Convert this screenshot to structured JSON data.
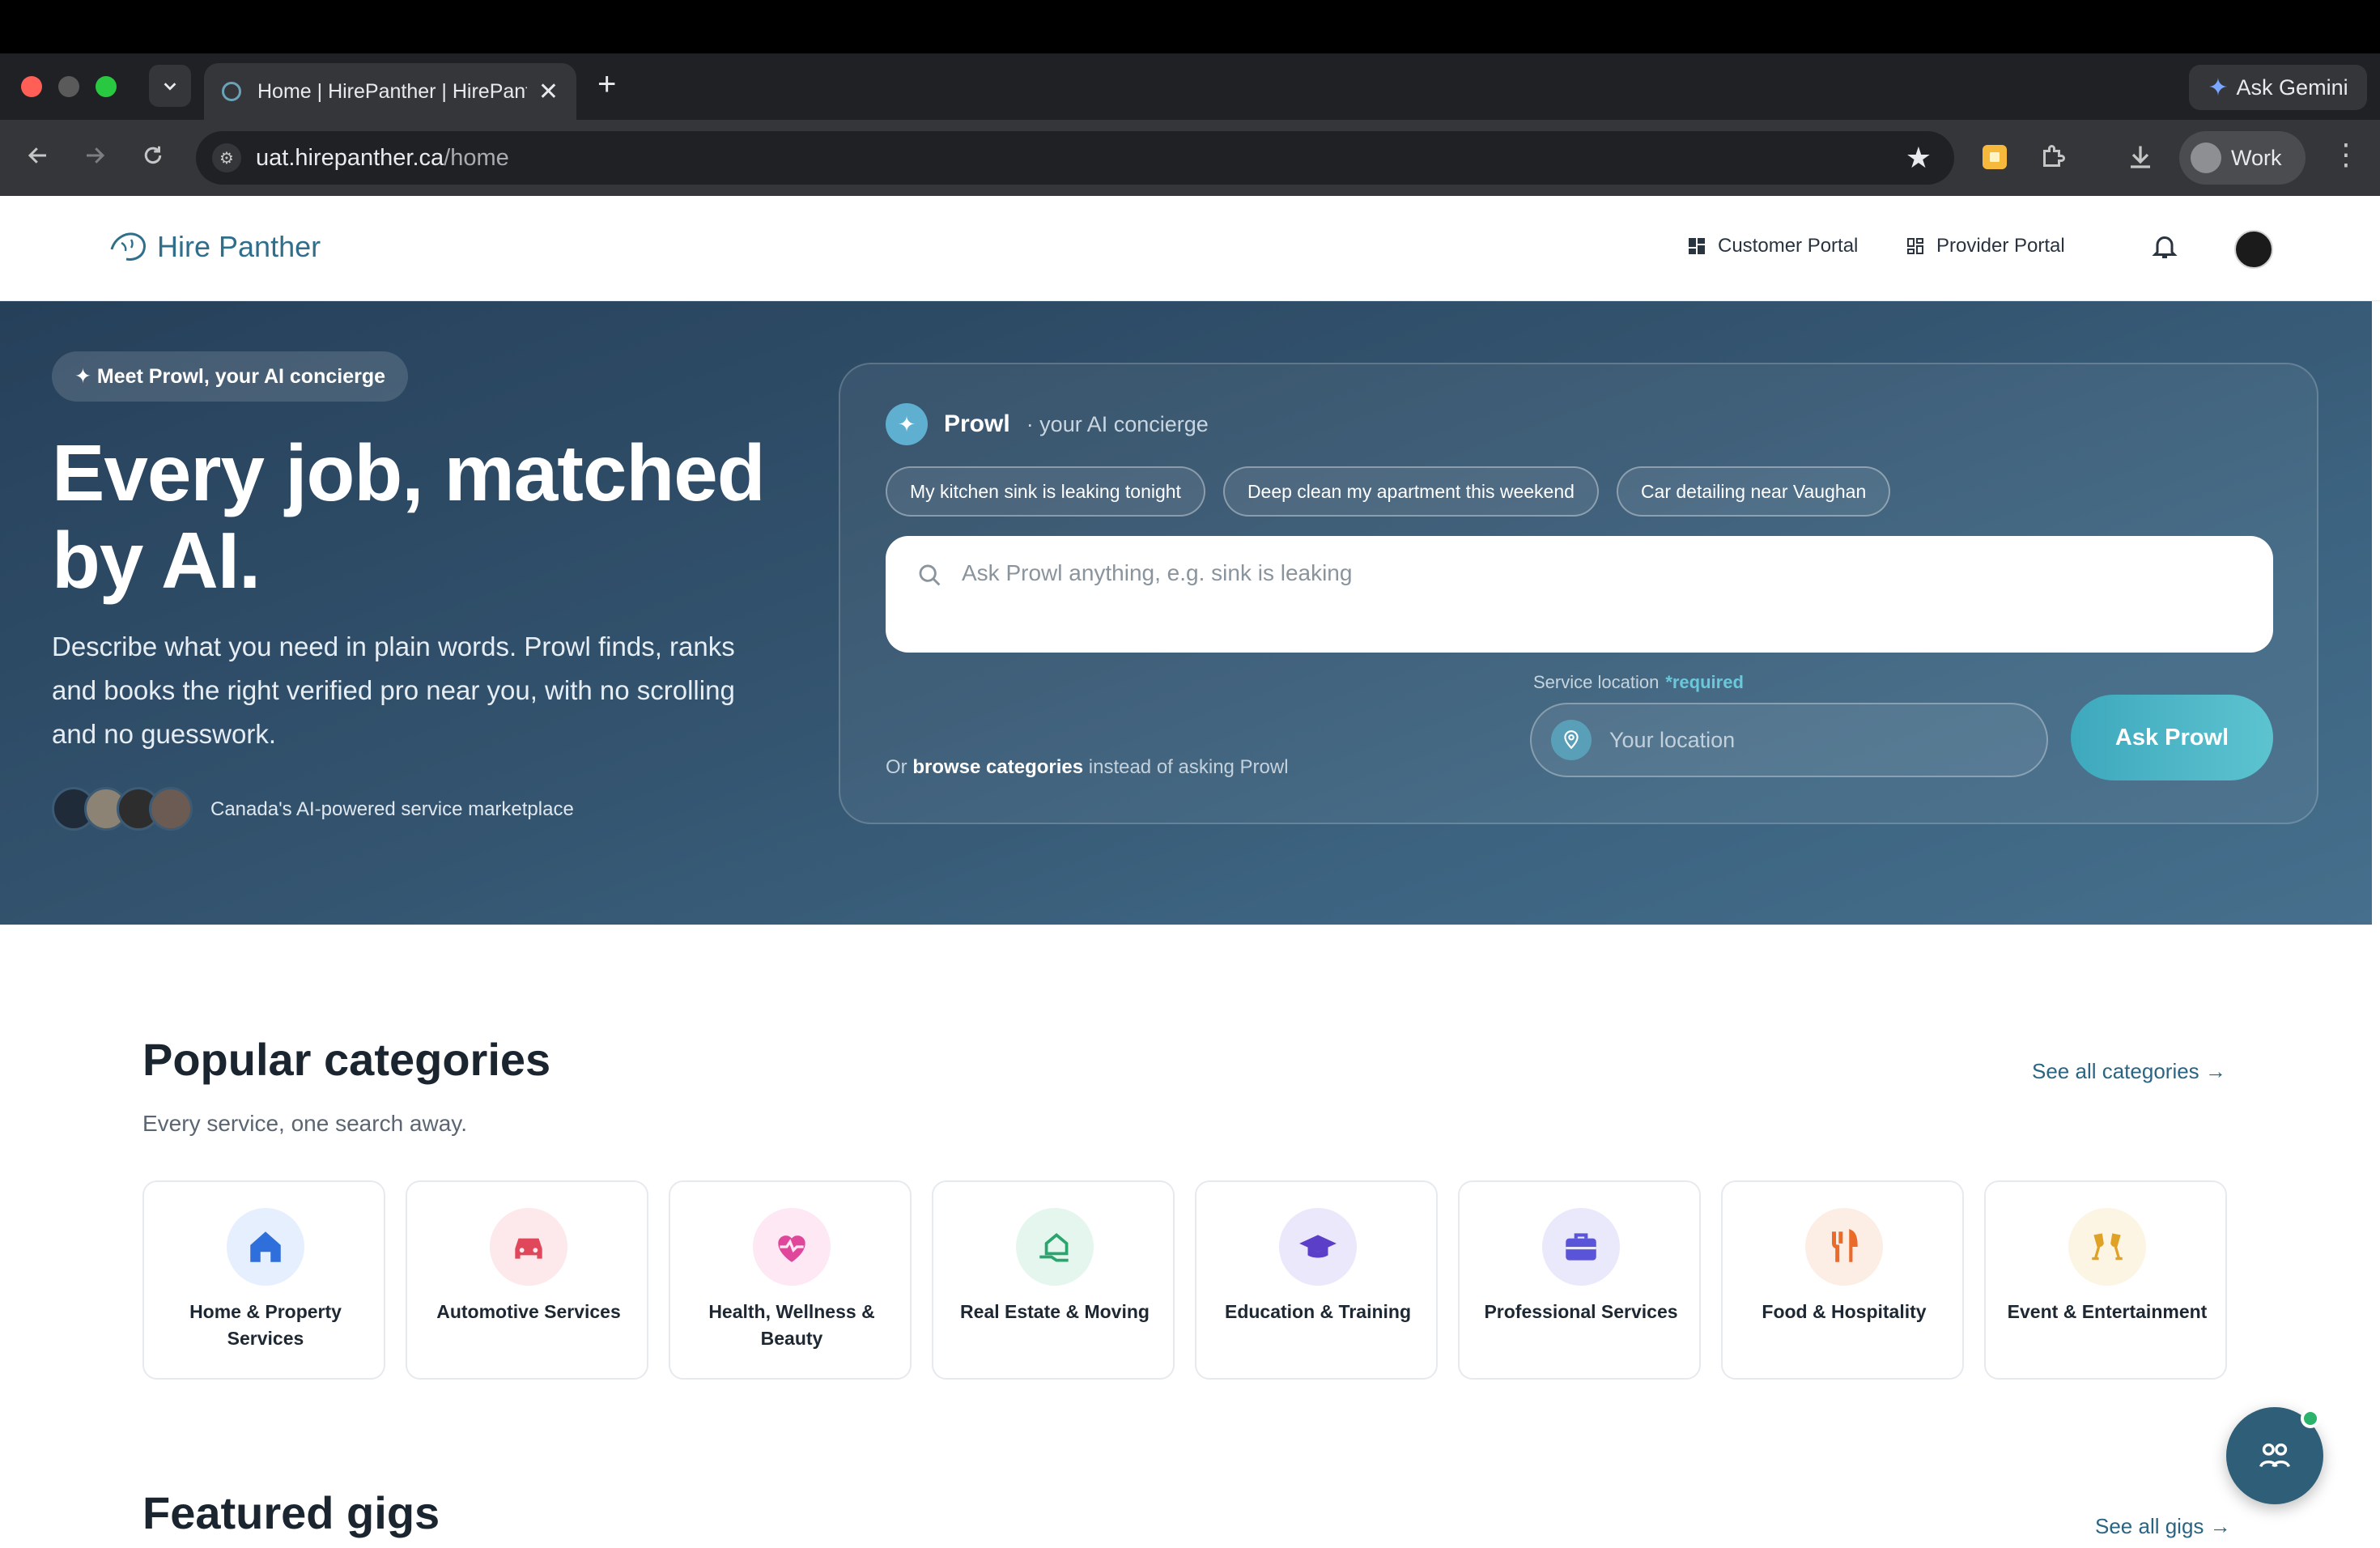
{
  "browser": {
    "tab_title": "Home | HirePanther | HirePanther",
    "url_host": "uat.hirepanther.ca",
    "url_path": "/home",
    "gemini_label": "Ask Gemini",
    "profile_label": "Work"
  },
  "header": {
    "logo_text": "Hire Panther",
    "customer_portal": "Customer Portal",
    "provider_portal": "Provider Portal"
  },
  "hero": {
    "pill": "✦ Meet Prowl, your AI concierge",
    "title": "Every job, matched by AI.",
    "subtitle": "Describe what you need in plain words. Prowl finds, ranks and books the right verified pro near you, with no scrolling and no guesswork.",
    "avatars_caption": "Canada's AI-powered service marketplace"
  },
  "prowl": {
    "name": "Prowl",
    "tagline": "· your AI concierge",
    "chips": [
      "My kitchen sink is leaking tonight",
      "Deep clean my apartment this weekend",
      "Car detailing near Vaughan"
    ],
    "search_placeholder": "Ask Prowl anything, e.g. sink is leaking",
    "location_label": "Service location",
    "location_required": "*required",
    "location_placeholder": "Your location",
    "ask_button": "Ask Prowl",
    "browse_prefix": "Or",
    "browse_link": "browse categories",
    "browse_suffix": "instead of asking Prowl"
  },
  "categories": {
    "title": "Popular categories",
    "subtitle": "Every service, one search away.",
    "see_all": "See all categories →",
    "items": [
      {
        "label": "Home & Property Services",
        "icon": "house-icon",
        "color": "#2f6fdc",
        "bg": "#e6effd"
      },
      {
        "label": "Automotive Services",
        "icon": "car-icon",
        "color": "#e0475a",
        "bg": "#fde8eb"
      },
      {
        "label": "Health, Wellness & Beauty",
        "icon": "heart-pulse-icon",
        "color": "#e0479a",
        "bg": "#fde8f4"
      },
      {
        "label": "Real Estate & Moving",
        "icon": "house-hand-icon",
        "color": "#2aa56d",
        "bg": "#e5f6ee"
      },
      {
        "label": "Education & Training",
        "icon": "graduation-cap-icon",
        "color": "#5b3fc9",
        "bg": "#ece8fb"
      },
      {
        "label": "Professional Services",
        "icon": "briefcase-icon",
        "color": "#5a55d8",
        "bg": "#eae9fb"
      },
      {
        "label": "Food & Hospitality",
        "icon": "utensils-icon",
        "color": "#ea6a2a",
        "bg": "#fdeee5"
      },
      {
        "label": "Event & Entertainment",
        "icon": "champagne-icon",
        "color": "#e0a226",
        "bg": "#fdf5e3"
      }
    ]
  },
  "featured": {
    "title": "Featured gigs",
    "see_all": "See all gigs →"
  }
}
